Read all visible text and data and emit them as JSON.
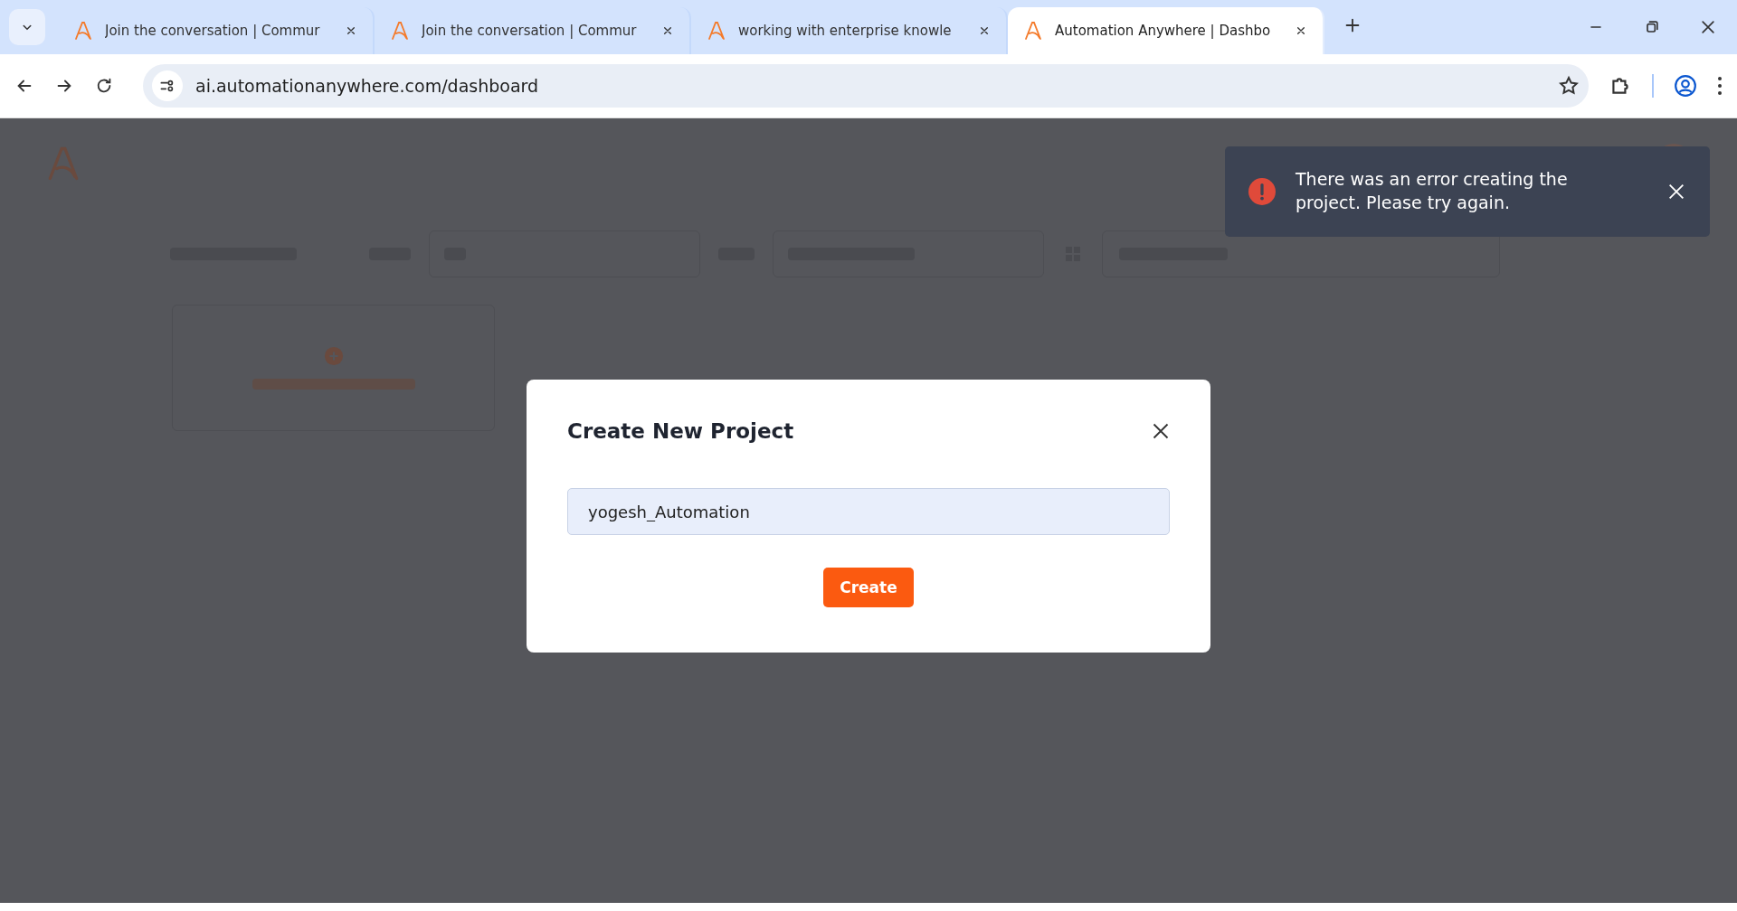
{
  "browser": {
    "tabs": [
      {
        "title": "Join the conversation | Commur",
        "selected": false
      },
      {
        "title": "Join the conversation | Commur",
        "selected": false
      },
      {
        "title": "working with enterprise knowle",
        "selected": false
      },
      {
        "title": "Automation Anywhere | Dashbo",
        "selected": true
      }
    ],
    "url": "ai.automationanywhere.com/dashboard"
  },
  "toast": {
    "message": "There was an error creating the project. Please try again."
  },
  "dialog": {
    "title": "Create New Project",
    "name_field": {
      "value": "yogesh_Automation"
    },
    "button": "Create"
  }
}
